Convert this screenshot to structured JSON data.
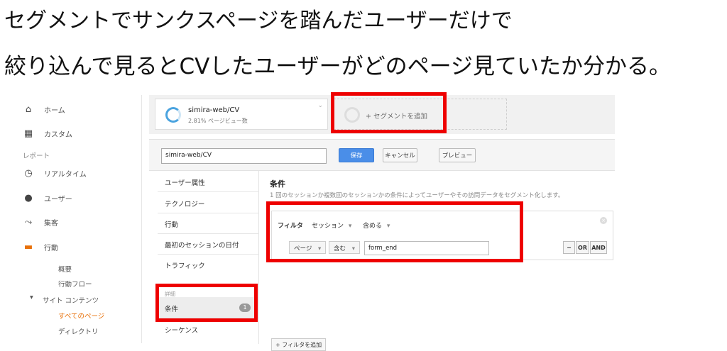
{
  "headings": {
    "line1": "セグメントでサンクスページを踏んだユーザーだけで",
    "line2": "絞り込んで見るとCVしたユーザーがどのページ見ていたか分かる。"
  },
  "sidebar": {
    "items": [
      {
        "label": "ホーム",
        "icon": "home-icon",
        "glyph": "⌂"
      },
      {
        "label": "カスタム",
        "icon": "dashboard-icon",
        "glyph": "▦"
      },
      {
        "label": "リアルタイム",
        "icon": "clock-icon",
        "glyph": "◷"
      },
      {
        "label": "ユーザー",
        "icon": "person-icon",
        "glyph": "●"
      },
      {
        "label": "集客",
        "icon": "acquisition-icon",
        "glyph": "⤳"
      },
      {
        "label": "行動",
        "icon": "behavior-icon",
        "glyph": "▬"
      }
    ],
    "reports_label": "レポート",
    "sub_items": [
      "概要",
      "行動フロー",
      "サイト コンテンツ",
      "すべてのページ",
      "ディレクトリ"
    ],
    "expand_glyph": "▾"
  },
  "segments": {
    "active_name": "simira-web/CV",
    "active_stat": "2.81% ページビュー数",
    "add_label": "+ セグメントを追加",
    "chevron": "⌄"
  },
  "editor": {
    "name_value": "simira-web/CV",
    "save": "保存",
    "cancel": "キャンセル",
    "preview": "プレビュー",
    "categories": [
      "ユーザー属性",
      "テクノロジー",
      "行動",
      "最初のセッションの日付",
      "トラフィック"
    ],
    "advanced_label": "詳細",
    "conditions_cat": "条件",
    "conditions_badge": "1",
    "sequence_cat": "シーケンス",
    "cond_title": "条件",
    "cond_desc": "1 回のセッションか複数回のセッションかの条件によってユーザーやその訪問データをセグメント化します。",
    "filter_label": "フィルタ",
    "scope": "セッション",
    "include": "含める",
    "dimension": "ページ",
    "operator": "含む",
    "value": "form_end",
    "minus": "−",
    "or": "OR",
    "and": "AND",
    "close_glyph": "×",
    "caret": "▾",
    "add_filter": "+ フィルタを追加"
  },
  "colors": {
    "highlight": "#ee0000",
    "accent_orange": "#e8710a",
    "save_blue": "#4a8ee8"
  }
}
